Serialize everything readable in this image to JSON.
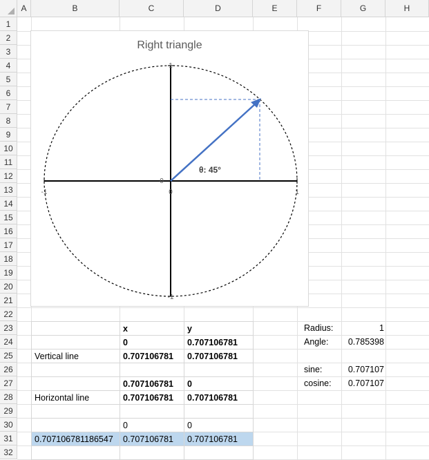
{
  "columns": [
    "A",
    "B",
    "C",
    "D",
    "E",
    "F",
    "G",
    "H"
  ],
  "rows": [
    "1",
    "2",
    "3",
    "4",
    "5",
    "6",
    "7",
    "8",
    "9",
    "10",
    "11",
    "12",
    "13",
    "14",
    "15",
    "16",
    "17",
    "18",
    "19",
    "20",
    "21",
    "22",
    "23",
    "24",
    "25",
    "26",
    "27",
    "28",
    "29",
    "30",
    "31",
    "32"
  ],
  "chart": {
    "title": "Right triangle",
    "angle_label": "θ: 45°",
    "tick_labels": {
      "top": "1",
      "bottom": "-1",
      "left": "-1",
      "right": "1",
      "origin_x": "0",
      "origin_y": "0"
    },
    "colors": {
      "arrow": "#4472c4",
      "axis": "#000000",
      "circle": "#000000",
      "dash_helper": "#4472c4"
    }
  },
  "chart_data": {
    "type": "scatter",
    "title": "Right triangle",
    "xlim": [
      -1,
      1
    ],
    "ylim": [
      -1,
      1
    ],
    "series": [
      {
        "values": [
          [
            0,
            0
          ],
          [
            0.707106781,
            0.707106781
          ]
        ]
      },
      {
        "values": [
          [
            0.707106781,
            0
          ],
          [
            0.707106781,
            0.707106781
          ]
        ]
      },
      {
        "values": [
          [
            0,
            0.707106781
          ],
          [
            0.707106781,
            0.707106781
          ]
        ]
      }
    ],
    "annotations": [
      "θ: 45°"
    ],
    "grid": false
  },
  "table": {
    "header": {
      "b": "",
      "c": "x",
      "d": "y"
    },
    "rows": [
      {
        "b": "",
        "c": "0",
        "d": "0.707106781",
        "bold": true
      },
      {
        "b": "Vertical line",
        "c": "0.707106781",
        "d": "0.707106781",
        "bold": true
      },
      {
        "b": "",
        "c": "",
        "d": "",
        "bold": false
      },
      {
        "b": "",
        "c": "0.707106781",
        "d": "0",
        "bold": true
      },
      {
        "b": "Horizontal line",
        "c": "0.707106781",
        "d": "0.707106781",
        "bold": true
      },
      {
        "b": "",
        "c": "",
        "d": "",
        "bold": false
      },
      {
        "b": "",
        "c": "0",
        "d": "0",
        "bold": false
      },
      {
        "b": "0.707106781186547",
        "c": "0.707106781",
        "d": "0.707106781",
        "bold": false,
        "selected": true
      },
      {
        "b": "",
        "c": "",
        "d": "",
        "bold": false
      }
    ]
  },
  "side": {
    "radius_label": "Radius:",
    "radius_value": "1",
    "angle_label": "Angle:",
    "angle_value": "0.785398",
    "sine_label": "sine:",
    "sine_value": "0.707107",
    "cosine_label": "cosine:",
    "cosine_value": "0.707107"
  }
}
